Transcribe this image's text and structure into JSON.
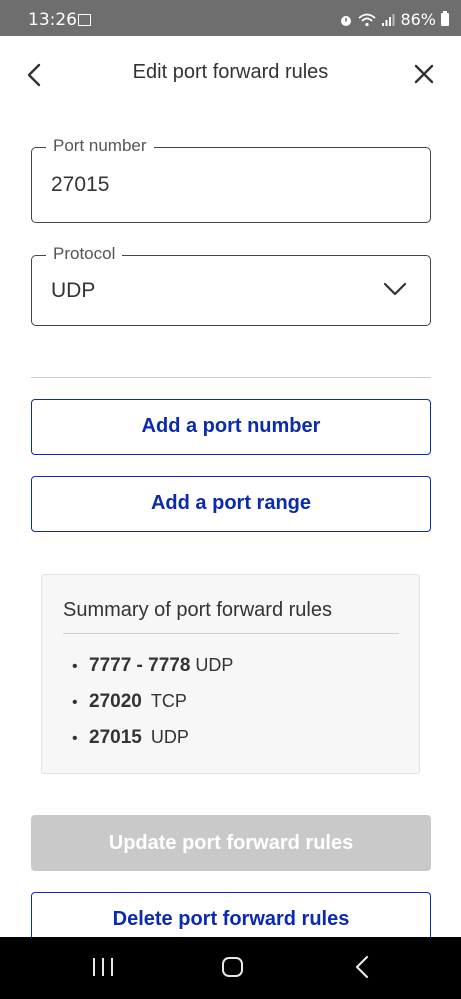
{
  "status_bar": {
    "time": "13:26",
    "battery": "86%",
    "icons": [
      "gallery-icon",
      "alarm-icon",
      "wifi-icon",
      "signal-icon",
      "battery-icon"
    ]
  },
  "header": {
    "title": "Edit port forward rules",
    "back_icon": "chevron-left-icon",
    "close_icon": "close-icon"
  },
  "form": {
    "port_number": {
      "label": "Port number",
      "value": "27015"
    },
    "protocol": {
      "label": "Protocol",
      "value": "UDP",
      "icon": "chevron-down-icon"
    }
  },
  "actions": {
    "add_port_number": "Add a port number",
    "add_port_range": "Add a port range",
    "update": "Update port forward rules",
    "delete": "Delete port forward rules"
  },
  "summary": {
    "title": "Summary of port forward rules",
    "items": [
      {
        "bullet": "•",
        "port": "7777 - 7778",
        "protocol": "UDP"
      },
      {
        "bullet": "•",
        "port": "27020",
        "protocol": "TCP"
      },
      {
        "bullet": "•",
        "port": "27015",
        "protocol": "UDP"
      }
    ]
  },
  "colors": {
    "accent": "#0a2bb0",
    "status_bar": "#6e6e6e",
    "disabled": "#c9c9c9",
    "nav_bar": "#000000"
  },
  "nav_bar": {
    "icons": [
      "recent-apps-icon",
      "home-icon",
      "back-icon"
    ]
  }
}
